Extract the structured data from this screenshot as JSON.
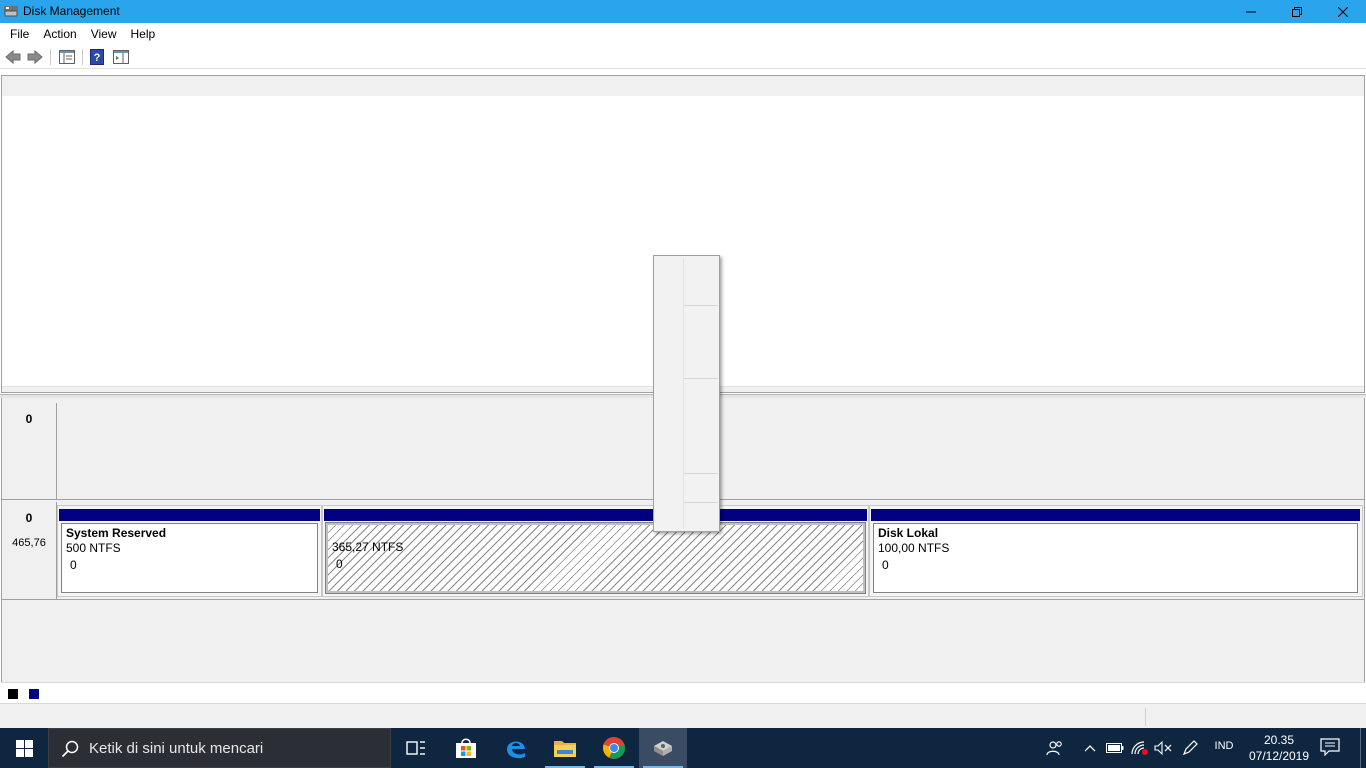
{
  "window": {
    "title": "Disk Management",
    "icon": "disk-management-icon"
  },
  "menu": {
    "items": [
      "File",
      "Action",
      "View",
      "Help"
    ]
  },
  "toolbar": {
    "buttons": [
      "back-arrow-icon",
      "forward-arrow-icon",
      "console-tree-icon",
      "help-icon",
      "action-pane-icon"
    ]
  },
  "disks": [
    {
      "number": "0",
      "size": ""
    },
    {
      "number": "0",
      "size": "465,76"
    }
  ],
  "volumes": [
    {
      "name": "System Reserved",
      "fs": "500  NTFS",
      "status": "0"
    },
    {
      "name": "",
      "fs": "365,27  NTFS",
      "status": "0"
    },
    {
      "name": "Disk Lokal",
      "fs": "100,00  NTFS",
      "status": "0"
    }
  ],
  "legend": {
    "colors": [
      "#000000",
      "#000080"
    ]
  },
  "taskbar": {
    "search_placeholder": "Ketik di sini untuk mencari",
    "apps": [
      "task-view-icon",
      "store-icon",
      "edge-icon",
      "file-explorer-icon",
      "chrome-icon",
      "disk-management-icon"
    ],
    "lang": "IND",
    "time": "20.35",
    "date": "07/12/2019"
  },
  "colors": {
    "titlebar": "#2aa4ec",
    "volume_header": "#000080",
    "taskbar": "#0f2641"
  }
}
